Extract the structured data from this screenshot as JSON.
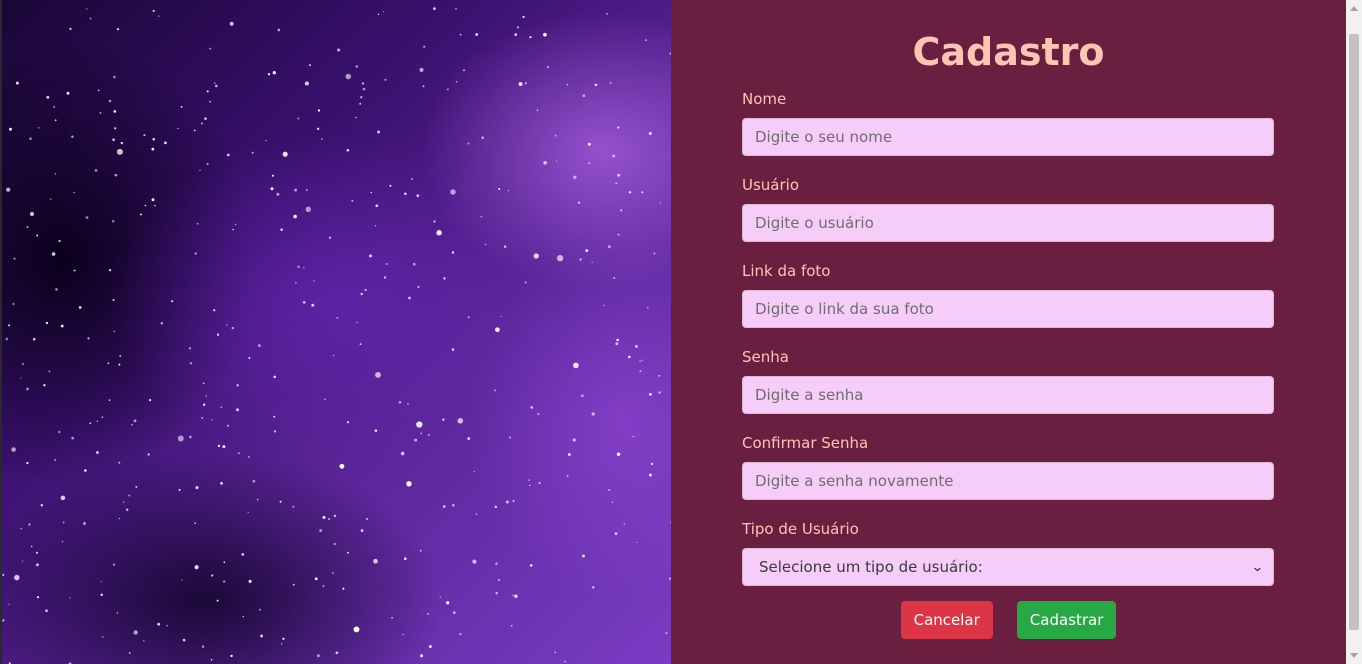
{
  "form": {
    "title": "Cadastro",
    "fields": [
      {
        "label": "Nome",
        "placeholder": "Digite o seu nome",
        "value": ""
      },
      {
        "label": "Usuário",
        "placeholder": "Digite o usuário",
        "value": ""
      },
      {
        "label": "Link da foto",
        "placeholder": "Digite o link da sua foto",
        "value": ""
      },
      {
        "label": "Senha",
        "placeholder": "Digite a senha",
        "value": ""
      },
      {
        "label": "Confirmar Senha",
        "placeholder": "Digite a senha novamente",
        "value": ""
      }
    ],
    "user_type": {
      "label": "Tipo de Usuário",
      "selected": "Selecione um tipo de usuário:"
    },
    "buttons": {
      "cancel": "Cancelar",
      "submit": "Cadastrar"
    }
  },
  "colors": {
    "panel_bg": "#6a1f40",
    "label_text": "#ffc5b3",
    "input_bg": "#f6ccf9",
    "cancel_button": "#dc3545",
    "submit_button": "#28a745"
  },
  "icons": {
    "select_arrow": "chevron-down-icon"
  }
}
